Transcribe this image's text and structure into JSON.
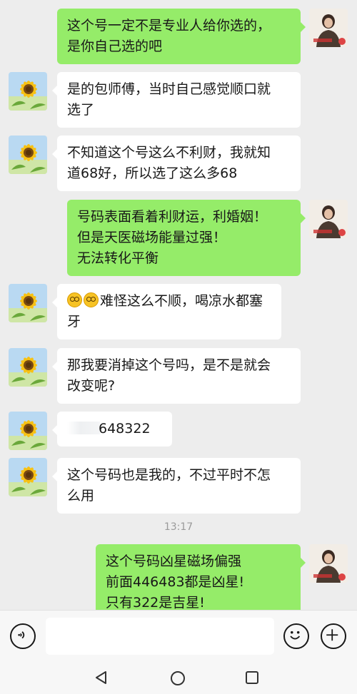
{
  "messages": [
    {
      "side": "right",
      "text": "这个号一定不是专业人给你选的，\n是你自己选的吧"
    },
    {
      "side": "left",
      "text": "是的包师傅，当时自己感觉顺口就\n选了"
    },
    {
      "side": "left",
      "text": "不知道这个号这么不利财，我就知\n道68好，所以选了这么多68"
    },
    {
      "side": "right",
      "text": "号码表面看着利财运，利婚姻！\n但是天医磁场能量过强！\n无法转化平衡"
    },
    {
      "side": "left",
      "text": "难怪这么不顺，喝凉水都塞\n牙",
      "emoji_count": 2
    },
    {
      "side": "left",
      "text": "那我要消掉这个号吗，是不是就会\n改变呢?"
    },
    {
      "side": "left",
      "text": "648322"
    },
    {
      "side": "left",
      "text": "这个号码也是我的，不过平时不怎\n么用"
    },
    {
      "side": "right",
      "text": "这个号码凶星磁场偏强\n前面446483都是凶星!\n只有322是吉星!"
    }
  ],
  "timestamp": "13:17",
  "input": {
    "placeholder": ""
  },
  "icons": {
    "voice": "voice-icon",
    "emoji": "emoji-icon",
    "plus": "plus-icon",
    "back": "nav-back-icon",
    "home": "nav-home-icon",
    "recents": "nav-recents-icon"
  },
  "colors": {
    "background": "#ededed",
    "bubble_right": "#95ec69",
    "bubble_left": "#ffffff"
  }
}
